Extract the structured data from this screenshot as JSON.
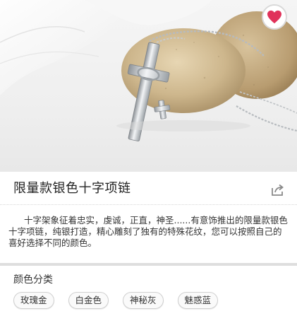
{
  "product": {
    "title": "限量款银色十字项链",
    "description": "十字架象征着忠实，虔诚，正直，神圣......有意饰推出的限量款银色十字项链，纯银打造，精心雕刻了独有的特殊花纹，您可以按照自己的喜好选择不同的颜色。",
    "favorite_icon": "heart-icon",
    "share_icon": "share-icon"
  },
  "color_section": {
    "label": "颜色分类",
    "options": [
      "玫瑰金",
      "白金色",
      "神秘灰",
      "魅惑蓝"
    ]
  },
  "colors": {
    "favorite": "#e0325a",
    "chip_border": "#cfcfcf",
    "section_bar": "#dedede"
  }
}
